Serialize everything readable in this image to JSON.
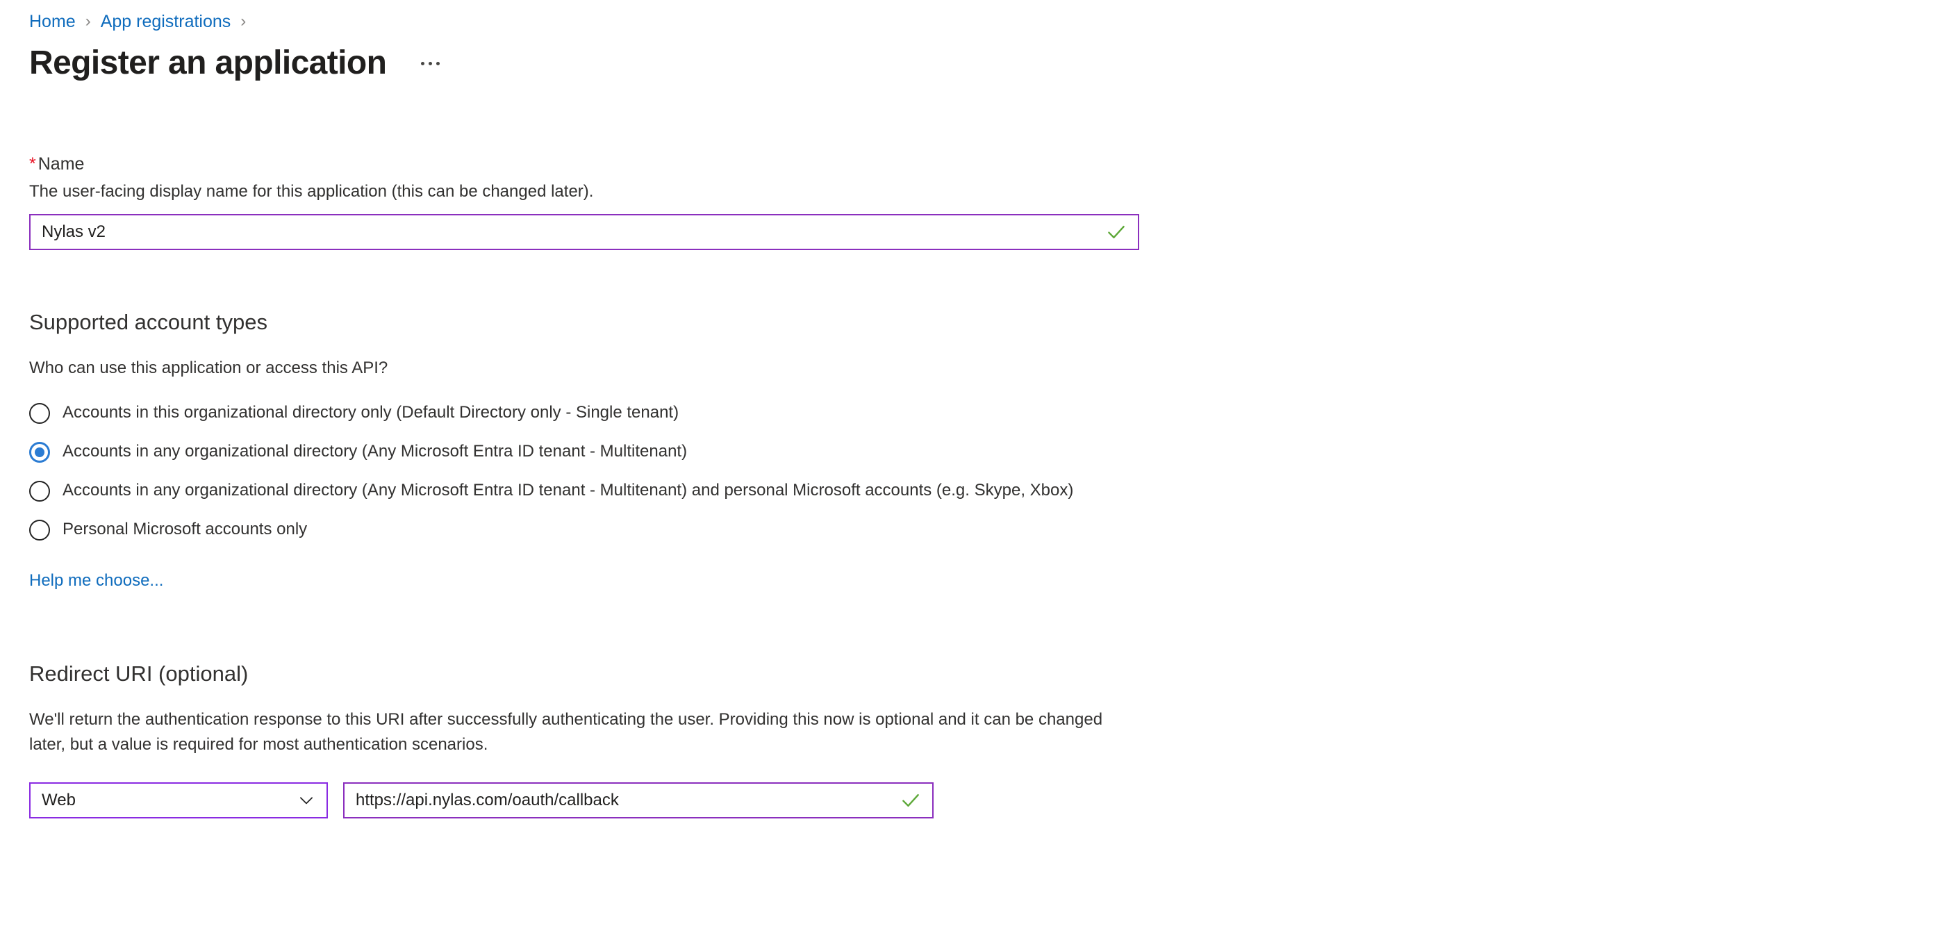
{
  "breadcrumb": {
    "items": [
      {
        "label": "Home"
      },
      {
        "label": "App registrations"
      }
    ],
    "separator": "›"
  },
  "header": {
    "title": "Register an application",
    "more_actions_label": "More actions"
  },
  "name_section": {
    "required_marker": "*",
    "label": "Name",
    "description": "The user-facing display name for this application (this can be changed later).",
    "value": "Nylas v2",
    "placeholder": "",
    "validation": "valid"
  },
  "account_types": {
    "heading": "Supported account types",
    "question": "Who can use this application or access this API?",
    "options": [
      {
        "label": "Accounts in this organizational directory only (Default Directory only - Single tenant)",
        "selected": false
      },
      {
        "label": "Accounts in any organizational directory (Any Microsoft Entra ID tenant - Multitenant)",
        "selected": true
      },
      {
        "label": "Accounts in any organizational directory (Any Microsoft Entra ID tenant - Multitenant) and personal Microsoft accounts (e.g. Skype, Xbox)",
        "selected": false
      },
      {
        "label": "Personal Microsoft accounts only",
        "selected": false
      }
    ],
    "help_link": "Help me choose..."
  },
  "redirect_uri": {
    "heading": "Redirect URI (optional)",
    "description": "We'll return the authentication response to this URI after successfully authenticating the user. Providing this now is optional and it can be changed later, but a value is required for most authentication scenarios.",
    "platform_value": "Web",
    "uri_value": "https://api.nylas.com/oauth/callback",
    "uri_placeholder": "e.g. https://example.com/auth",
    "validation": "valid"
  },
  "colors": {
    "link_blue": "#0f6cbd",
    "radio_selected_blue": "#2b7cd3",
    "input_border_purple": "#8a2be2",
    "valid_check_green": "#5da838",
    "required_red": "#e81123",
    "text_primary": "#323130",
    "background": "#ffffff"
  }
}
